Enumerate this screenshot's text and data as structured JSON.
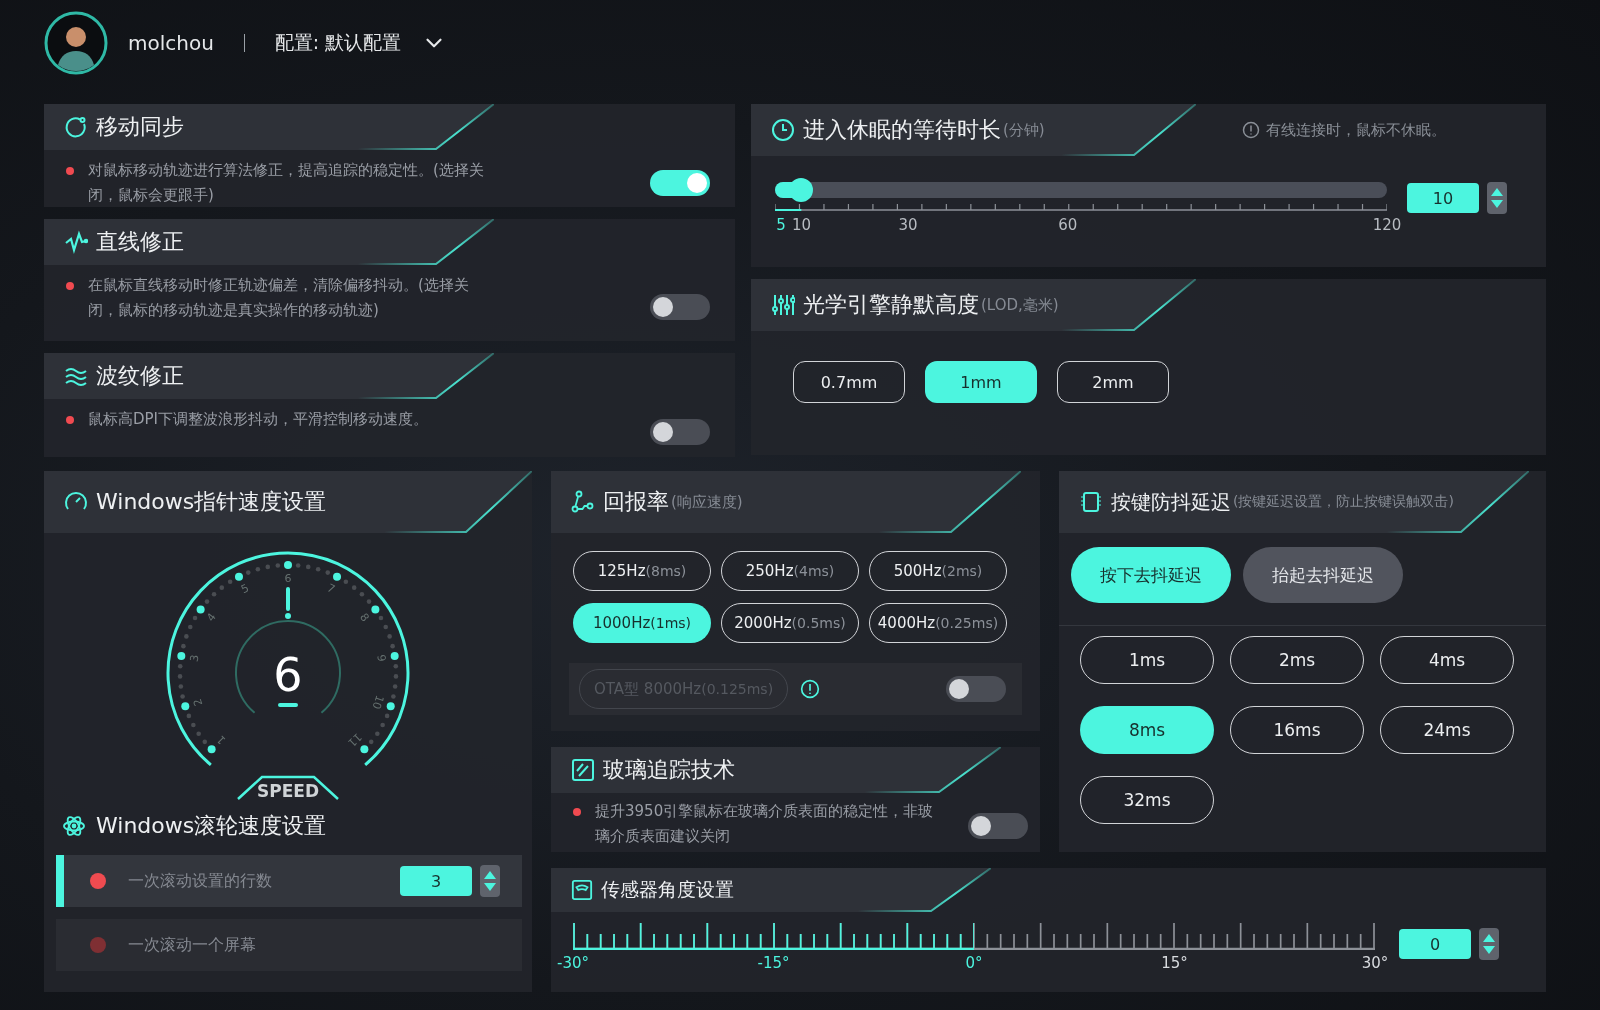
{
  "header": {
    "username": "molchou",
    "profile_label": "配置: 默认配置"
  },
  "feature_toggles": [
    {
      "title": "移动同步",
      "description": "对鼠标移动轨迹进行算法修正，提高追踪的稳定性。(选择关闭，鼠标会更跟手)",
      "on": true
    },
    {
      "title": "直线修正",
      "description": "在鼠标直线移动时修正轨迹偏差，清除偏移抖动。(选择关闭，鼠标的移动轨迹是真实操作的移动轨迹)",
      "on": false
    },
    {
      "title": "波纹修正",
      "description": "鼠标高DPI下调整波浪形抖动，平滑控制移动速度。",
      "on": false
    }
  ],
  "sleep": {
    "title": "进入休眠的等待时长",
    "unit": "(分钟)",
    "note": "有线连接时，鼠标不休眠。",
    "level": 0.043,
    "value": "10",
    "ticks": [
      "5",
      "10",
      "30",
      "60",
      "120"
    ]
  },
  "lod": {
    "title": "光学引擎静默高度",
    "unit": "(LOD,毫米)",
    "options": [
      {
        "label": "0.7mm",
        "selected": false
      },
      {
        "label": "1mm",
        "selected": true
      },
      {
        "label": "2mm",
        "selected": false
      }
    ]
  },
  "pointer_speed": {
    "title": "Windows指针速度设置",
    "value": "6",
    "caption": "SPEED",
    "level": 0.5,
    "dial_labels": [
      "1",
      "2",
      "3",
      "4",
      "5",
      "6",
      "7",
      "8",
      "9",
      "10",
      "11"
    ]
  },
  "scroll_speed": {
    "title": "Windows滚轮速度设置",
    "options": [
      {
        "label": "一次滚动设置的行数",
        "selected": true,
        "value": "3"
      },
      {
        "label": "一次滚动一个屏幕",
        "selected": false
      }
    ]
  },
  "report_rate": {
    "title": "回报率",
    "unit": "(响应速度)",
    "options": [
      {
        "rate": "125Hz",
        "period": "(8ms)",
        "selected": false
      },
      {
        "rate": "250Hz",
        "period": "(4ms)",
        "selected": false
      },
      {
        "rate": "500Hz",
        "period": "(2ms)",
        "selected": false
      },
      {
        "rate": "1000Hz",
        "period": "(1ms)",
        "selected": true
      },
      {
        "rate": "2000Hz",
        "period": "(0.5ms)",
        "selected": false
      },
      {
        "rate": "4000Hz",
        "period": "(0.25ms)",
        "selected": false
      }
    ],
    "ota": {
      "rate": "OTA型 8000Hz",
      "period": "(0.125ms)",
      "disabled": true,
      "on": false
    }
  },
  "glass_tracking": {
    "title": "玻璃追踪技术",
    "description": "提升3950引擎鼠标在玻璃介质表面的稳定性，非玻璃介质表面建议关闭",
    "on": false
  },
  "debounce": {
    "title": "按键防抖延迟",
    "subtitle": "(按键延迟设置，防止按键误触双击)",
    "modes": [
      {
        "label": "按下去抖延迟",
        "selected": true
      },
      {
        "label": "抬起去抖延迟",
        "selected": false
      }
    ],
    "options": [
      {
        "label": "1ms",
        "selected": false
      },
      {
        "label": "2ms",
        "selected": false
      },
      {
        "label": "4ms",
        "selected": false
      },
      {
        "label": "8ms",
        "selected": true
      },
      {
        "label": "16ms",
        "selected": false
      },
      {
        "label": "24ms",
        "selected": false
      },
      {
        "label": "32ms",
        "selected": false
      }
    ]
  },
  "sensor_angle": {
    "title": "传感器角度设置",
    "level": 0.5,
    "value": "0",
    "ticks": [
      "-30°",
      "-15°",
      "0°",
      "15°",
      "30°"
    ]
  }
}
